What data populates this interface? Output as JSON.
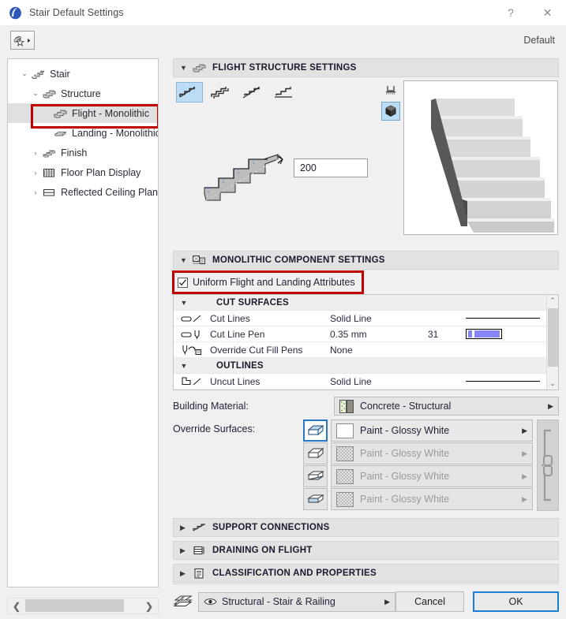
{
  "window": {
    "title": "Stair Default Settings",
    "help_label": "?",
    "close_label": "✕"
  },
  "toolbar": {
    "favorites_label": "Favorites",
    "default_label": "Default"
  },
  "sidebar": {
    "items": [
      {
        "label": "Stair",
        "level": 0,
        "twisty": "⌄",
        "icon": "stair-icon",
        "selected": false
      },
      {
        "label": "Structure",
        "level": 1,
        "twisty": "⌄",
        "icon": "structure-icon",
        "selected": false
      },
      {
        "label": "Flight - Monolithic",
        "level": 2,
        "twisty": "",
        "icon": "flight-monolithic-icon",
        "selected": true
      },
      {
        "label": "Landing - Monolithic",
        "level": 2,
        "twisty": "",
        "icon": "landing-monolithic-icon",
        "selected": false
      },
      {
        "label": "Finish",
        "level": 1,
        "twisty": "›",
        "icon": "finish-icon",
        "selected": false
      },
      {
        "label": "Floor Plan Display",
        "level": 1,
        "twisty": "›",
        "icon": "floor-plan-display-icon",
        "selected": false
      },
      {
        "label": "Reflected Ceiling Plan Di",
        "level": 1,
        "twisty": "›",
        "icon": "reflected-ceiling-plan-icon",
        "selected": false
      }
    ],
    "scroll_left": "❮",
    "scroll_right": "❯"
  },
  "flight_structure": {
    "title": "FLIGHT STRUCTURE SETTINGS",
    "triangle": "▼",
    "types": [
      {
        "name": "monolithic-type",
        "selected": true
      },
      {
        "name": "stepped-type",
        "selected": false
      },
      {
        "name": "open-riser-type",
        "selected": false
      },
      {
        "name": "cantilevered-type",
        "selected": false
      }
    ],
    "view_buttons": [
      {
        "name": "plan-view-button",
        "selected": false
      },
      {
        "name": "3d-view-button",
        "selected": true
      }
    ],
    "thickness_value": "200"
  },
  "monolithic": {
    "title": "MONOLITHIC COMPONENT SETTINGS",
    "triangle": "▼",
    "uniform_checkbox_label": "Uniform Flight and Landing Attributes",
    "uniform_checked": true,
    "attribute_groups": [
      {
        "group": "CUT SURFACES",
        "triangle": "▼",
        "rows": [
          {
            "icon": "cut-lines-icon",
            "name": "Cut Lines",
            "value": "Solid Line",
            "value2": "",
            "display": "line"
          },
          {
            "icon": "cut-line-pen-icon",
            "name": "Cut Line Pen",
            "value": "0.35 mm",
            "value2": "31",
            "display": "pen"
          },
          {
            "icon": "override-cut-fill-pens-icon",
            "name": "Override Cut Fill Pens",
            "value": "None",
            "value2": "",
            "display": "none"
          }
        ]
      },
      {
        "group": "OUTLINES",
        "triangle": "▼",
        "rows": [
          {
            "icon": "uncut-lines-icon",
            "name": "Uncut Lines",
            "value": "Solid Line",
            "value2": "",
            "display": "line"
          }
        ]
      }
    ],
    "scroll_up": "⌃",
    "scroll_down": "⌄",
    "building_material_label": "Building Material:",
    "building_material_value": "Concrete - Structural",
    "override_surfaces_label": "Override Surfaces:",
    "surfaces": [
      {
        "icon": "surface-top-icon",
        "value": "Paint - Glossy White",
        "enabled": true
      },
      {
        "icon": "surface-bottom-icon",
        "value": "Paint - Glossy White",
        "enabled": false
      },
      {
        "icon": "surface-side-icon",
        "value": "Paint - Glossy White",
        "enabled": false
      },
      {
        "icon": "surface-edge-icon",
        "value": "Paint - Glossy White",
        "enabled": false
      }
    ],
    "link_icon": "chain-link-icon",
    "dropdown_arrow": "▶"
  },
  "collapsed_sections": [
    {
      "title": "SUPPORT CONNECTIONS",
      "triangle": "▶",
      "icon": "support-connections-icon"
    },
    {
      "title": "DRAINING ON FLIGHT",
      "triangle": "▶",
      "icon": "draining-on-flight-icon"
    },
    {
      "title": "CLASSIFICATION AND PROPERTIES",
      "triangle": "▶",
      "icon": "classification-properties-icon"
    }
  ],
  "footer": {
    "layer_value": "Structural - Stair & Railing",
    "layer_arrow": "▶",
    "cancel_label": "Cancel",
    "ok_label": "OK"
  },
  "colors": {
    "accent_blue": "#1a7fd4",
    "highlight_red": "#c00000",
    "selection_blue": "#bcdcf4",
    "pen_color": "#8585f5",
    "window_bg": "#f0f0f0"
  }
}
